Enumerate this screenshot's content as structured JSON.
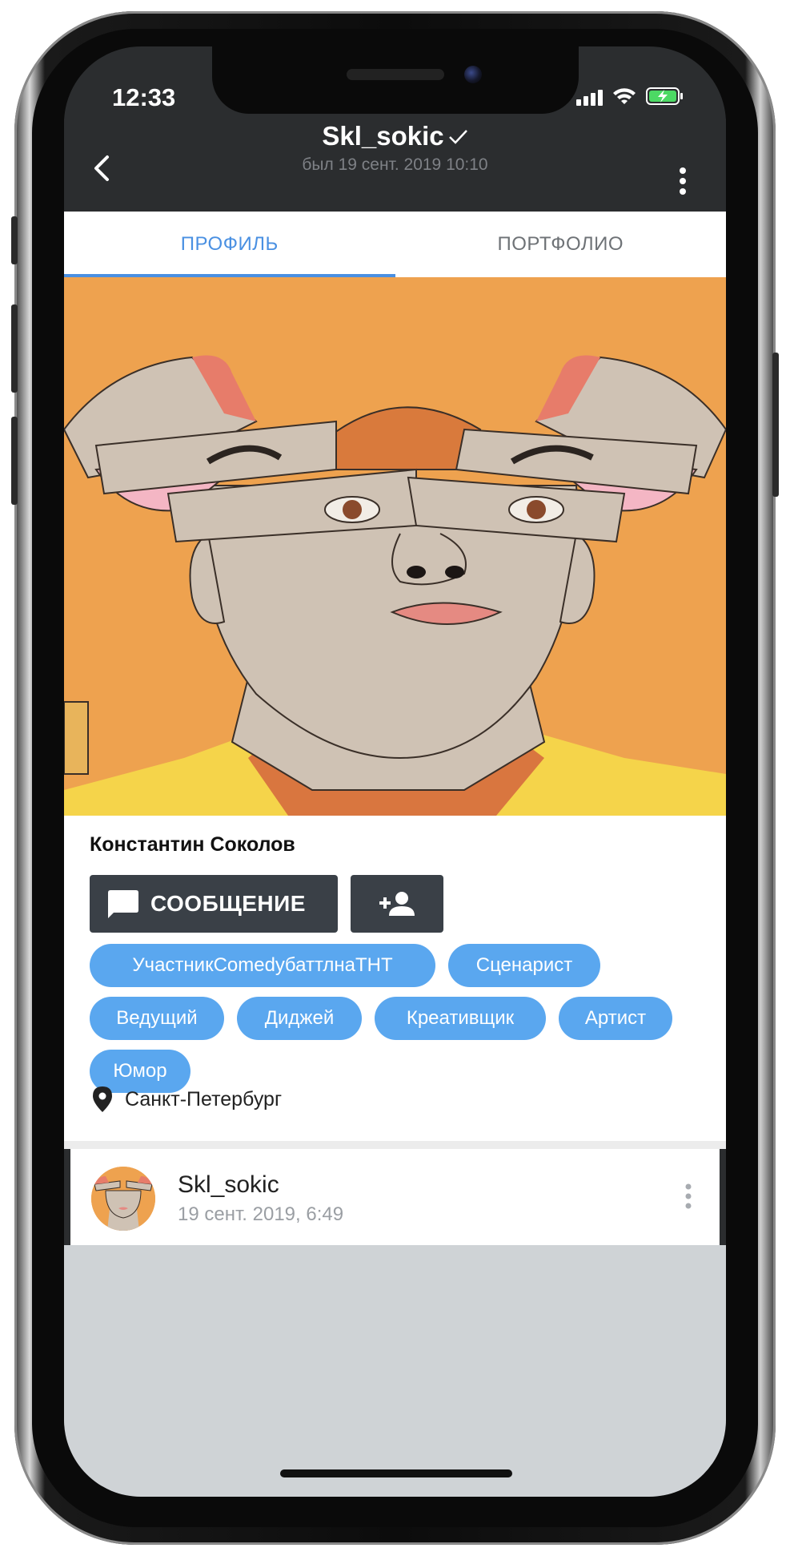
{
  "status_bar": {
    "time": "12:33"
  },
  "header": {
    "username": "Skl_sokic",
    "last_seen": "был 19 сент. 2019 10:10"
  },
  "tabs": [
    {
      "label": "ПРОФИЛЬ",
      "active": true
    },
    {
      "label": "ПОРТФОЛИО",
      "active": false
    }
  ],
  "profile": {
    "full_name": "Константин Соколов",
    "message_button": "СООБЩЕНИЕ",
    "tags": [
      "УчастникComedyбаттлнаТНТ",
      "Сценарист",
      "Ведущий",
      "Диджей",
      "Креативщик",
      "Артист",
      "Юмор"
    ],
    "city": "Санкт-Петербург"
  },
  "post": {
    "author": "Skl_sokic",
    "date": "19 сент. 2019, 6:49"
  },
  "colors": {
    "accent": "#4a90e2",
    "chip": "#5aa7ef",
    "app_bar": "#2b2d2f",
    "button": "#3a4047",
    "hero_bg": "#eea24f"
  }
}
